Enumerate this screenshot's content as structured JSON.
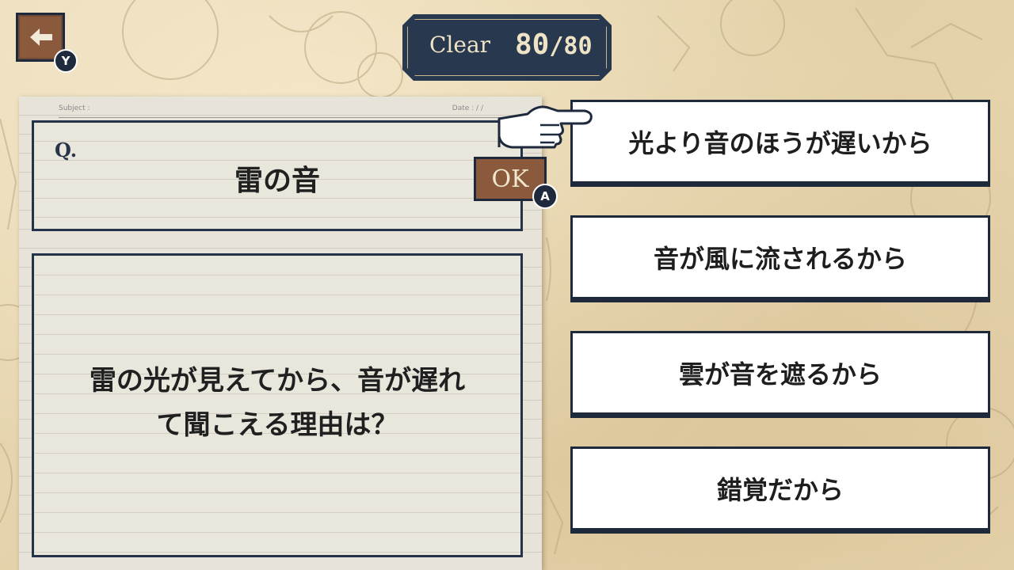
{
  "header": {
    "back_button_hint": "Y",
    "clear_label": "Clear",
    "clear_count": "80",
    "clear_separator": "/",
    "clear_total": "80"
  },
  "notebook": {
    "subject_label": "Subject :",
    "date_label": "Date :   /   /"
  },
  "question": {
    "q_label": "Q.",
    "title": "雷の音",
    "ok_label": "OK",
    "ok_hint": "A",
    "text_line1": "雷の光が見えてから、音が遅れ",
    "text_line2": "て聞こえる理由は？"
  },
  "answers": [
    {
      "label": "光より音のほうが遅いから"
    },
    {
      "label": "音が風に流されるから"
    },
    {
      "label": "雲が音を遮るから"
    },
    {
      "label": "錯覚だから"
    }
  ],
  "colors": {
    "navy": "#1e2a3c",
    "brown_button": "#8b5a3c",
    "parchment": "#e8d8b4",
    "paper": "#e7e3d8"
  }
}
